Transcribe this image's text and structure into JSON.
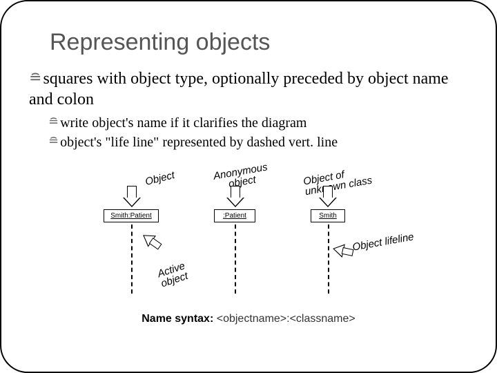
{
  "title": "Representing objects",
  "bullets": {
    "main": "squares with object type, optionally preceded by object name and colon",
    "sub1": "write object's name if it clarifies the diagram",
    "sub2": "object's \"life line\" represented by dashed vert. line"
  },
  "bullet_glyph": "≘",
  "diagram": {
    "obj1": "Smith:Patient",
    "obj2": ":Patient",
    "obj3": "Smith",
    "label_object": "Object",
    "label_anon": "Anonymous\nobject",
    "label_unknown": "Object of\nunknown class",
    "label_active": "Active\nobject",
    "label_lifeline": "Object lifeline"
  },
  "syntax": {
    "label": "Name syntax:",
    "value": "<objectname>:<classname>"
  }
}
